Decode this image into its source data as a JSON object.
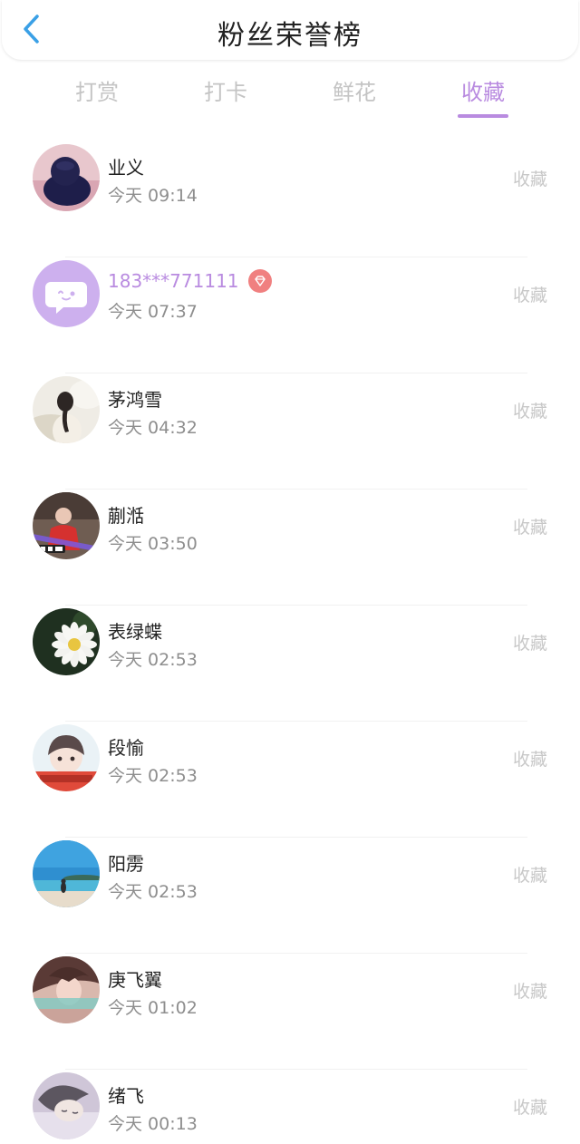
{
  "header": {
    "title": "粉丝荣誉榜",
    "back_icon": "chevron-left-icon"
  },
  "tabs": [
    {
      "label": "打赏",
      "active": false
    },
    {
      "label": "打卡",
      "active": false
    },
    {
      "label": "鲜花",
      "active": false
    },
    {
      "label": "收藏",
      "active": true
    }
  ],
  "colors": {
    "accent": "#b98be0",
    "back_icon": "#3aa0e6",
    "vip_badge": "#f08080",
    "muted_text": "#c8c8c8",
    "time_text": "#8e8e8e"
  },
  "fans": [
    {
      "name": "业义",
      "time": "今天 09:14",
      "action": "收藏",
      "avatar": "dark-hat-avatar"
    },
    {
      "name": "183***771111",
      "time": "今天 07:37",
      "action": "收藏",
      "avatar": "default-chat-avatar",
      "vip": true,
      "badge_icon": "diamond-icon"
    },
    {
      "name": "茅鸿雪",
      "time": "今天 04:32",
      "action": "收藏",
      "avatar": "girl-back-avatar"
    },
    {
      "name": "蒯湉",
      "time": "今天 03:50",
      "action": "收藏",
      "avatar": "red-dress-avatar"
    },
    {
      "name": "表绿蝶",
      "time": "今天 02:53",
      "action": "收藏",
      "avatar": "white-flower-avatar"
    },
    {
      "name": "段愉",
      "time": "今天 02:53",
      "action": "收藏",
      "avatar": "girl-bangs-avatar"
    },
    {
      "name": "阳雳",
      "time": "今天 02:53",
      "action": "收藏",
      "avatar": "beach-avatar"
    },
    {
      "name": "庚飞翼",
      "time": "今天 01:02",
      "action": "收藏",
      "avatar": "long-hair-avatar"
    },
    {
      "name": "绪飞",
      "time": "今天 00:13",
      "action": "收藏",
      "avatar": "sleeping-girl-avatar"
    }
  ]
}
